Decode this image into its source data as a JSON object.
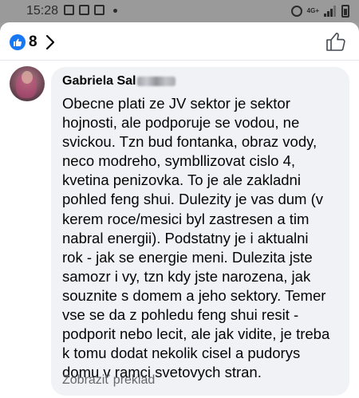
{
  "status_bar": {
    "time": "15:28",
    "network": "4G+"
  },
  "reactions": {
    "count": "8",
    "like_color": "#1877f2"
  },
  "comment": {
    "author": "Gabriela Sal",
    "text": "Obecne plati ze JV sektor je sektor\nhojnosti, ale podporuje se vodou, ne\nsvickou. Tzn bud fontanka, obraz vody,\nneco modreho, symbllizovat cislo 4,\nkvetina penizovka. To je ale zakladni\npohled feng shui. Dulezity je vas dum (v\nkerem roce/mesici byl zastresen a tim\nnabral energii). Podstatny je i aktualni\nrok - jak se energie meni. Dulezita jste\nsamozr i vy, tzn kdy jste narozena, jak\nsouznite s domem a jeho sektory. Temer\nvse se da z pohledu feng shui resit -\npodporit nebo lecit, ale jak vidite, je treba\nk tomu dodat nekolik cisel a pudorys\ndomu v ramci svetovych stran.",
    "translate_label": "Zobraziť preklad"
  }
}
